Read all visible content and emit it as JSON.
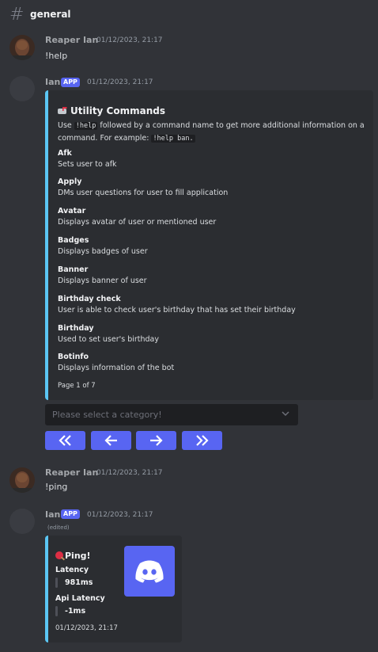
{
  "channel": {
    "name": "general"
  },
  "messages": [
    {
      "user": "Reaper Ian",
      "time": "01/12/2023, 21:17",
      "text": "!help"
    },
    {
      "user": "Ian",
      "badge": "APP",
      "time": "01/12/2023, 21:17"
    },
    {
      "user": "Reaper Ian",
      "time": "01/12/2023, 21:17",
      "text": "!ping"
    },
    {
      "user": "Ian",
      "badge": "APP",
      "time": "01/12/2023, 21:17",
      "edited": "(edited)"
    }
  ],
  "help_embed": {
    "title": "Utility Commands",
    "desc_pre": "Use ",
    "desc_code1": "!help",
    "desc_mid": " followed by a command name to get more additional information on a command. For example: ",
    "desc_code2": "!help ban.",
    "fields": [
      {
        "name": "Afk",
        "value": "Sets user to afk"
      },
      {
        "name": "Apply",
        "value": "DMs user questions for user to fill application"
      },
      {
        "name": "Avatar",
        "value": "Displays avatar of user or mentioned user"
      },
      {
        "name": "Badges",
        "value": "Displays badges of user"
      },
      {
        "name": "Banner",
        "value": "Displays banner of user"
      },
      {
        "name": "Birthday check",
        "value": "User is able to check user's birthday that has set their birthday"
      },
      {
        "name": "Birthday",
        "value": "Used to set user's birthday"
      },
      {
        "name": "Botinfo",
        "value": "Displays information of the bot"
      }
    ],
    "footer": "Page 1 of 7",
    "accent": "#5bc6f4"
  },
  "select": {
    "placeholder": "Please select a category!"
  },
  "buttons": [
    "first-page",
    "previous-page",
    "next-page",
    "last-page"
  ],
  "ping_embed": {
    "title": "Ping!",
    "fields": [
      {
        "name": "Latency",
        "value": "981ms"
      },
      {
        "name": "Api Latency",
        "value": "-1ms"
      }
    ],
    "footer": "01/12/2023, 21:17",
    "thumb_color": "#5865f2"
  }
}
